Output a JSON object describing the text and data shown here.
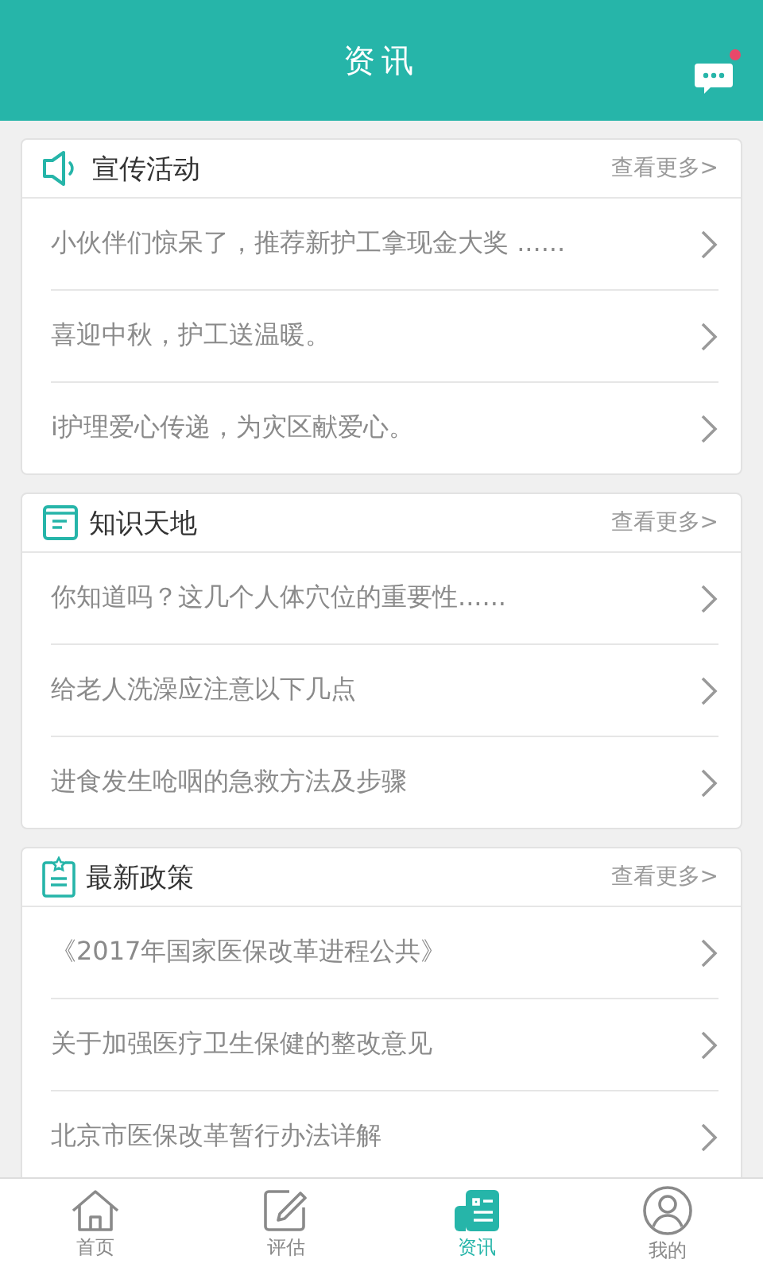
{
  "header": {
    "title": "资讯",
    "has_notification": true
  },
  "sections": [
    {
      "kind": "speaker",
      "title": "宣传活动",
      "more": "查看更多>",
      "items": [
        "小伙伴们惊呆了，推荐新护工拿现金大奖 ......",
        "喜迎中秋，护工送温暖。",
        "i护理爱心传递，为灾区献爱心。"
      ]
    },
    {
      "kind": "book",
      "title": "知识天地",
      "more": "查看更多>",
      "items": [
        "你知道吗？这几个人体穴位的重要性......",
        "给老人洗澡应注意以下几点",
        "进食发生呛咽的急救方法及步骤"
      ]
    },
    {
      "kind": "clipboard",
      "title": "最新政策",
      "more": "查看更多>",
      "items": [
        "《2017年国家医保改革进程公共》",
        "关于加强医疗卫生保健的整改意见",
        "北京市医保改革暂行办法详解"
      ]
    }
  ],
  "tabs": [
    {
      "kind": "home",
      "label": "首页",
      "selected": false
    },
    {
      "kind": "edit",
      "label": "评估",
      "selected": false
    },
    {
      "kind": "news",
      "label": "资讯",
      "selected": true
    },
    {
      "kind": "profile",
      "label": "我的",
      "selected": false
    }
  ]
}
